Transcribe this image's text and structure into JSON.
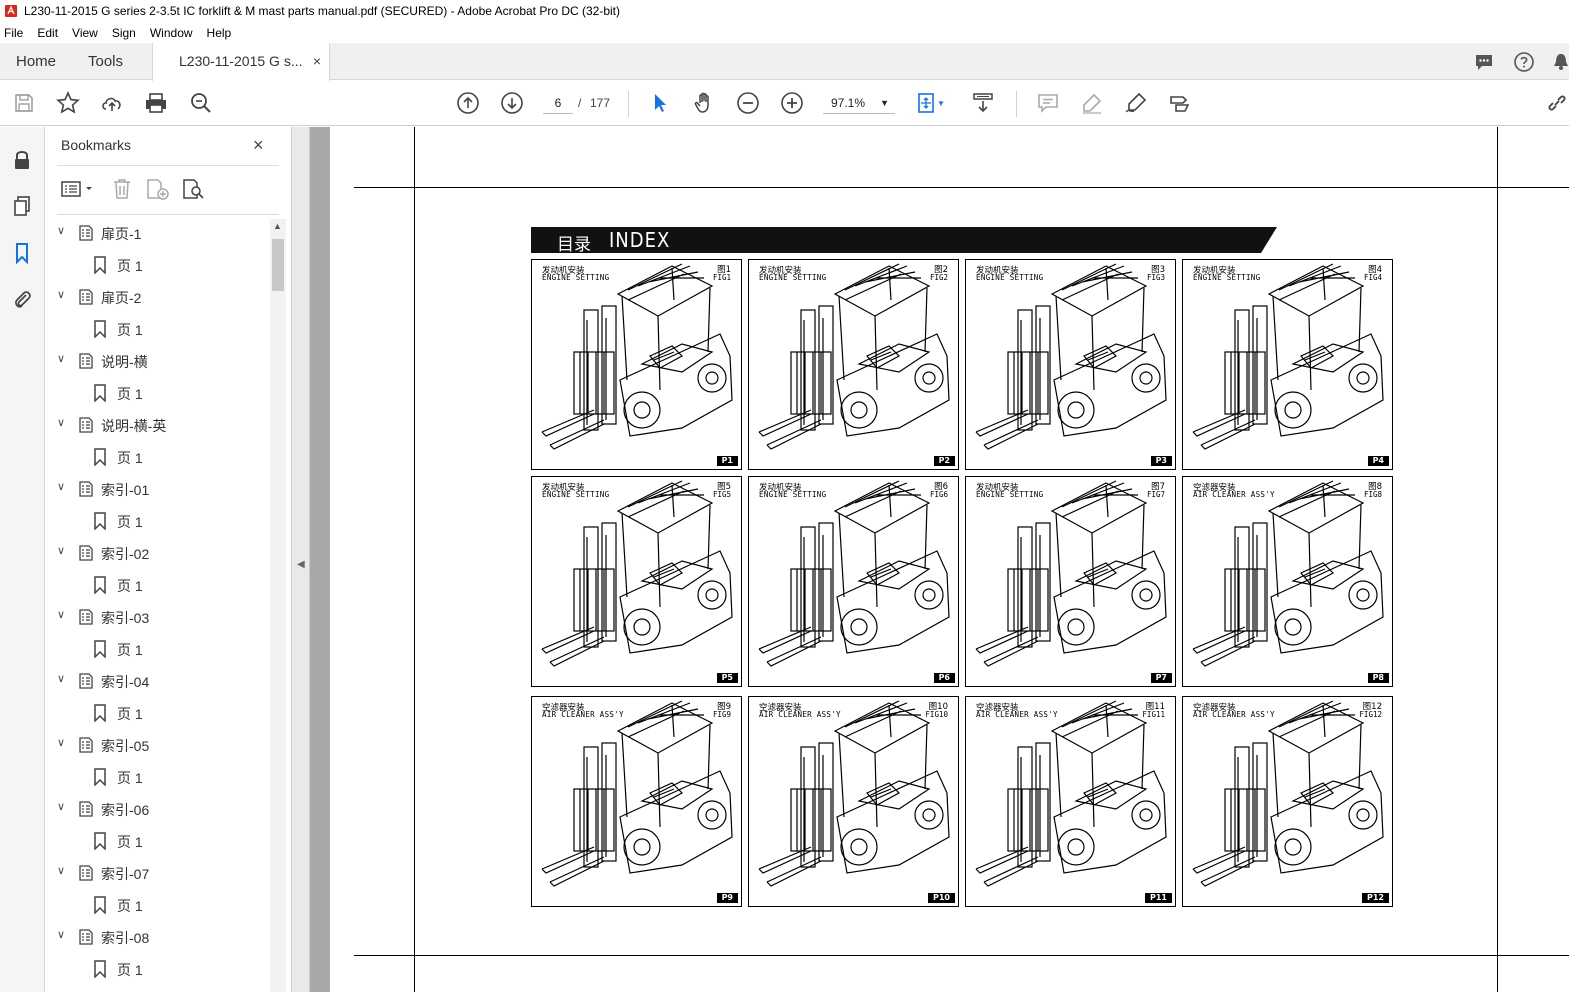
{
  "window": {
    "title": "L230-11-2015 G series 2-3.5t IC forklift & M mast parts manual.pdf (SECURED) - Adobe Acrobat Pro DC (32-bit)"
  },
  "menu": [
    "File",
    "Edit",
    "View",
    "Sign",
    "Window",
    "Help"
  ],
  "tabs": {
    "home": "Home",
    "tools": "Tools",
    "document": "L230-11-2015 G s...",
    "close": "×"
  },
  "toolbar": {
    "current_page": "6",
    "page_sep": "/",
    "total_pages": "177",
    "zoom": "97.1%"
  },
  "bookmarks": {
    "title": "Bookmarks",
    "close": "×",
    "items": [
      {
        "label": "扉页-1",
        "child": "页 1"
      },
      {
        "label": "扉页-2",
        "child": "页 1"
      },
      {
        "label": "说明-横",
        "child": "页 1"
      },
      {
        "label": "说明-横-英",
        "child": "页 1"
      },
      {
        "label": "索引-01",
        "child": "页 1"
      },
      {
        "label": "索引-02",
        "child": "页 1"
      },
      {
        "label": "索引-03",
        "child": "页 1"
      },
      {
        "label": "索引-04",
        "child": "页 1"
      },
      {
        "label": "索引-05",
        "child": "页 1"
      },
      {
        "label": "索引-06",
        "child": "页 1"
      },
      {
        "label": "索引-07",
        "child": "页 1"
      },
      {
        "label": "索引-08",
        "child": "页 1"
      }
    ]
  },
  "document": {
    "index_cn": "目录",
    "index_en": "INDEX",
    "figures": [
      {
        "cn": "发动机安装",
        "en": "ENGINE SETTING",
        "no_cn": "图1",
        "no_en": "FIG1",
        "page": "P1"
      },
      {
        "cn": "发动机安装",
        "en": "ENGINE SETTING",
        "no_cn": "图2",
        "no_en": "FIG2",
        "page": "P2"
      },
      {
        "cn": "发动机安装",
        "en": "ENGINE SETTING",
        "no_cn": "图3",
        "no_en": "FIG3",
        "page": "P3"
      },
      {
        "cn": "发动机安装",
        "en": "ENGINE SETTING",
        "no_cn": "图4",
        "no_en": "FIG4",
        "page": "P4"
      },
      {
        "cn": "发动机安装",
        "en": "ENGINE SETTING",
        "no_cn": "图5",
        "no_en": "FIG5",
        "page": "P5"
      },
      {
        "cn": "发动机安装",
        "en": "ENGINE SETTING",
        "no_cn": "图6",
        "no_en": "FIG6",
        "page": "P6"
      },
      {
        "cn": "发动机安装",
        "en": "ENGINE SETTING",
        "no_cn": "图7",
        "no_en": "FIG7",
        "page": "P7"
      },
      {
        "cn": "空滤器安装",
        "en": "AIR CLEANER ASS'Y",
        "no_cn": "图8",
        "no_en": "FIG8",
        "page": "P8"
      },
      {
        "cn": "空滤器安装",
        "en": "AIR CLEANER ASS'Y",
        "no_cn": "图9",
        "no_en": "FIG9",
        "page": "P9"
      },
      {
        "cn": "空滤器安装",
        "en": "AIR CLEANER ASS'Y",
        "no_cn": "图10",
        "no_en": "FIG10",
        "page": "P10"
      },
      {
        "cn": "空滤器安装",
        "en": "AIR CLEANER ASS'Y",
        "no_cn": "图11",
        "no_en": "FIG11",
        "page": "P11"
      },
      {
        "cn": "空滤器安装",
        "en": "AIR CLEANER ASS'Y",
        "no_cn": "图12",
        "no_en": "FIG12",
        "page": "P12"
      }
    ]
  }
}
